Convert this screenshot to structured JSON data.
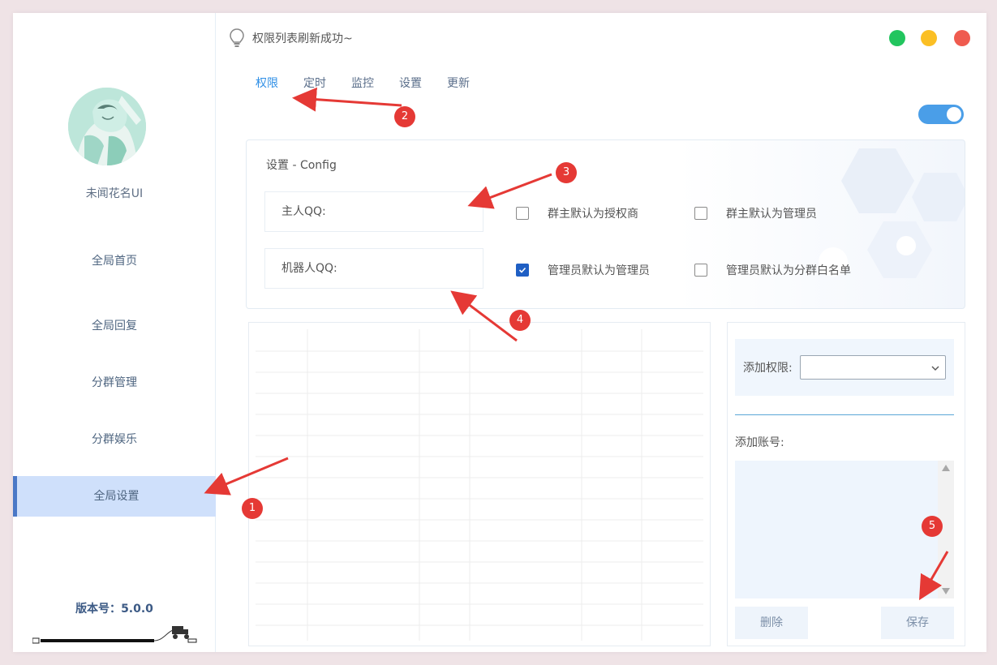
{
  "window": {
    "status_message": "权限列表刷新成功~"
  },
  "sidebar": {
    "app_name": "未闻花名UI",
    "items": [
      {
        "label": "全局首页"
      },
      {
        "label": "全局回复"
      },
      {
        "label": "分群管理"
      },
      {
        "label": "分群娱乐"
      },
      {
        "label": "全局设置",
        "active": true
      }
    ],
    "version_label": "版本号：",
    "version_value": "5.0.0"
  },
  "tabs": [
    {
      "label": "权限",
      "active": true
    },
    {
      "label": "定时"
    },
    {
      "label": "监控"
    },
    {
      "label": "设置"
    },
    {
      "label": "更新"
    }
  ],
  "toggle": {
    "on": true
  },
  "config": {
    "title": "设置 - Config",
    "owner_qq_label": "主人QQ:",
    "robot_qq_label": "机器人QQ:",
    "checkboxes": [
      {
        "label": "群主默认为授权商",
        "checked": false
      },
      {
        "label": "群主默认为管理员",
        "checked": false
      },
      {
        "label": "管理员默认为管理员",
        "checked": true
      },
      {
        "label": "管理员默认为分群白名单",
        "checked": false
      }
    ]
  },
  "right_panel": {
    "add_permission_label": "添加权限:",
    "add_permission_value": "",
    "add_account_label": "添加账号:",
    "delete_label": "删除",
    "save_label": "保存"
  },
  "annotations": [
    "1",
    "2",
    "3",
    "4",
    "5"
  ],
  "colors": {
    "accent": "#2f8fe6",
    "sidebar_active": "#cfe0fb",
    "annotation_red": "#e53935",
    "window_green": "#22c55e",
    "window_yellow": "#fbbf24",
    "window_red": "#ef5b4f"
  }
}
